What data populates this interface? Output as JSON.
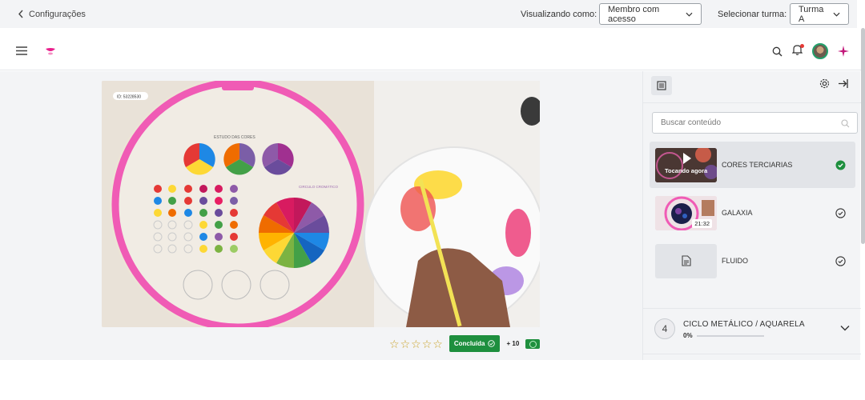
{
  "topbar": {
    "back_label": "Configurações",
    "view_as_label": "Visualizando como:",
    "view_as_value": "Membro com acesso",
    "class_label": "Selecionar turma:",
    "class_value": "Turma A"
  },
  "navbar": {
    "brand_color": "#e91e8c",
    "icons": [
      "menu-icon",
      "search-icon",
      "bell-icon",
      "avatar",
      "sparkle-icon"
    ]
  },
  "video": {
    "id_label": "ID: 53228530",
    "sheet_title": "ESTUDO DAS CORES",
    "wheel_label": "CIRCULO CROMÁTICO"
  },
  "rating": {
    "stars": 5,
    "done_label": "Concluída",
    "points_label": "+ 10"
  },
  "sidebar": {
    "search_placeholder": "Buscar conteúdo",
    "items": [
      {
        "title": "CORES TERCIARIAS",
        "badge": "Tocando agora",
        "status": "completed"
      },
      {
        "title": "GALAXIA",
        "badge": "21:32",
        "status": "check"
      },
      {
        "title": "FLUIDO",
        "badge": "",
        "status": "check"
      }
    ],
    "module": {
      "number": "4",
      "title": "CICLO METÁLICO / AQUARELA",
      "progress": "0%"
    }
  },
  "colors": {
    "accent_green": "#1e8f3e",
    "hoop_pink": "#f05bb5"
  }
}
